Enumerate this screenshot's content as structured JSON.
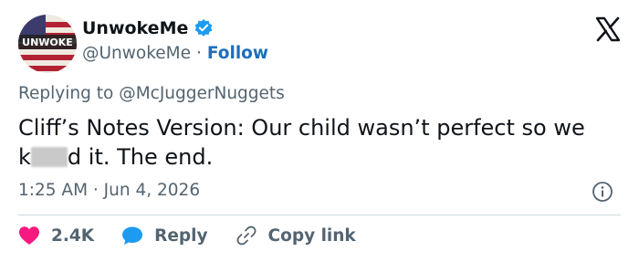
{
  "author": {
    "avatar_text": "UNWOKE",
    "display_name": "UnwokeMe",
    "handle": "@UnwokeMe",
    "separator": "·",
    "follow_label": "Follow",
    "verified": true
  },
  "reply_context": {
    "prefix": "Replying to",
    "mention": "@McJuggerNuggets"
  },
  "tweet": {
    "text_part1": "Cliff’s Notes Version: Our child wasn’t perfect so we k",
    "text_part2": "d it. The end.",
    "timestamp": "1:25 AM · Jun 4, 2026"
  },
  "actions": {
    "likes": "2.4K",
    "reply_label": "Reply",
    "copy_label": "Copy link"
  },
  "colors": {
    "verified": "#1d9bf0",
    "like": "#f91880",
    "reply": "#1d9bf0",
    "link": "#1d6fbf"
  },
  "icons": {
    "platform": "x-logo-icon",
    "info": "info-icon",
    "like": "heart-icon",
    "reply": "speech-bubble-icon",
    "copy": "link-icon"
  }
}
